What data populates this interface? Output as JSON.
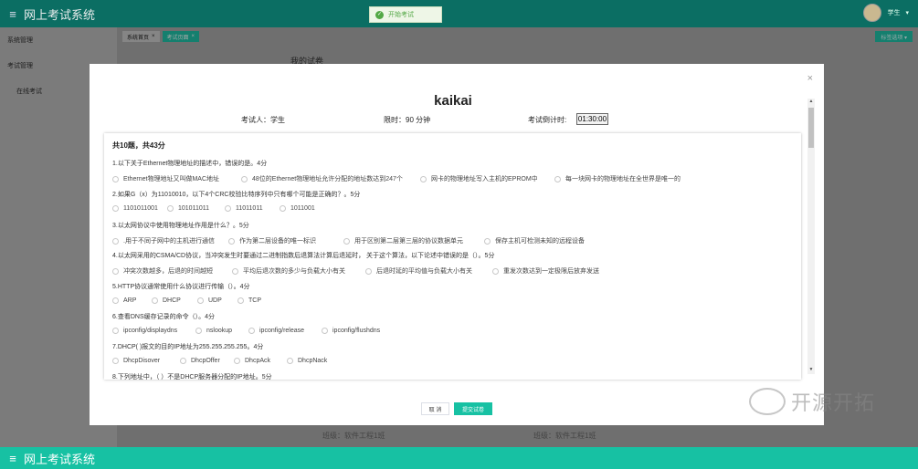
{
  "topbar": {
    "title": "网上考试系统",
    "user_name": "学生",
    "caret": "▾"
  },
  "toast": {
    "text": "开始考试",
    "icon": "✓"
  },
  "sidebar": {
    "items": [
      {
        "label": "系统管理"
      },
      {
        "label": "考试管理"
      },
      {
        "label": "在线考试"
      }
    ]
  },
  "tabs": [
    {
      "label": "系统首页"
    },
    {
      "label": "考试页面"
    }
  ],
  "tab_close": "×",
  "right_button": "标签选项 ▾",
  "background": {
    "title": "我的试卷",
    "class1": "班级：软件工程1班",
    "class2": "班级：软件工程1班"
  },
  "bottombar": {
    "title": "网上考试系统"
  },
  "modal": {
    "close": "×",
    "exam_title": "kaikai",
    "examinee": "考试人：学生",
    "duration": "限时：90 分钟",
    "countdown_label": "考试倒计时:",
    "countdown_value": "01:30:00",
    "summary": "共10题，共43分",
    "questions": [
      {
        "text": "1.以下关于Ethernet物理地址的描述中，错误的是。4分",
        "options": [
          "Ethernet物理地址又叫做MAC地址",
          "48位的Ethernet物理地址允许分配的地址数达到247个",
          "网卡的物理地址写入主机的EPROM中",
          "每一块网卡的物理地址在全世界是唯一的"
        ]
      },
      {
        "text": "2.如果G（x）为11010010，以下4个CRC校验比特序列中只有哪个可能是正确的？。5分",
        "options": [
          "1101011001",
          "101011011",
          "11011011",
          "1011001"
        ]
      },
      {
        "text": "3.以太网协议中使用物理地址作用是什么？。5分",
        "options": [
          ".用于不同子网中的主机进行通信",
          "作为第二层设备的唯一标识",
          "用于区别第二层第三层的协议数据单元",
          "保存主机可检测未知的远程设备"
        ]
      },
      {
        "text": "4.以太网采用的CSMA/CD协议，当冲突发生时要通过二进制指数后退算法计算后退延时， 关于这个算法，以下论述中错误的是（）。5分",
        "options": [
          "冲突次数越多，后退的时间越短",
          "平均后退次数的多少与负载大小有关",
          "后退时延的平均值与负载大小有关",
          "重发次数达到一定极限后放弃发送"
        ]
      },
      {
        "text": "5.HTTP协议通常使用什么协议进行传输（）。4分",
        "options": [
          "ARP",
          "DHCP",
          "UDP",
          "TCP"
        ]
      },
      {
        "text": "6.查看DNS缓存记录的命令（）。4分",
        "options": [
          "ipconfig/displaydns",
          "nslookup",
          "ipconfig/release",
          "ipconfig/flushdns"
        ]
      },
      {
        "text": "7.DHCP( )报文的目的IP地址为255.255.255.255。4分",
        "options": [
          "DhcpDisover",
          "DhcpOffer",
          "DhcpAck",
          "DhcpNack"
        ]
      },
      {
        "text": "8.下列地址中，（ ）不是DHCP服务器分配的IP地址。5分",
        "options": []
      }
    ],
    "cancel_label": "取 消",
    "submit_label": "提交试卷"
  },
  "scroll": {
    "up": "▲",
    "down": "▼"
  },
  "watermark": {
    "text": "开源开拓"
  }
}
